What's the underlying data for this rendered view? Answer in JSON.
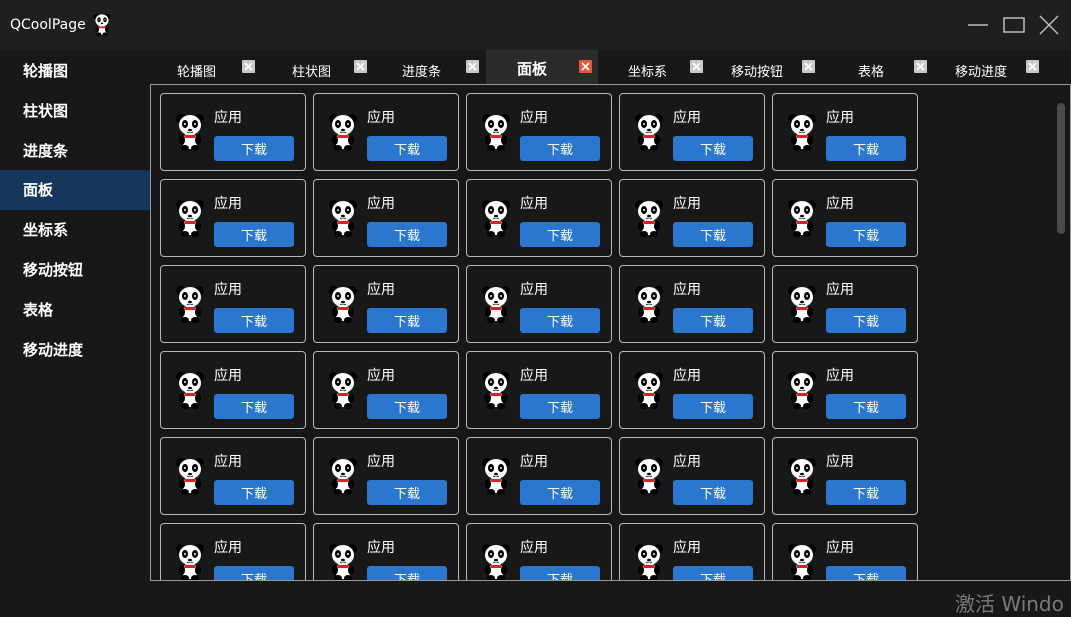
{
  "window": {
    "title": "QCoolPage"
  },
  "sidebar": {
    "items": [
      {
        "label": "轮播图"
      },
      {
        "label": "柱状图"
      },
      {
        "label": "进度条"
      },
      {
        "label": "面板"
      },
      {
        "label": "坐标系"
      },
      {
        "label": "移动按钮"
      },
      {
        "label": "表格"
      },
      {
        "label": "移动进度"
      }
    ],
    "active_index": 3
  },
  "tabs": {
    "items": [
      {
        "label": "轮播图"
      },
      {
        "label": "柱状图"
      },
      {
        "label": "进度条"
      },
      {
        "label": "面板"
      },
      {
        "label": "坐标系"
      },
      {
        "label": "移动按钮"
      },
      {
        "label": "表格"
      },
      {
        "label": "移动进度"
      }
    ],
    "active_index": 3
  },
  "panel": {
    "rows": 6,
    "cols": 5,
    "card": {
      "title": "应用",
      "button": "下载"
    }
  },
  "watermark": "激活 Windo",
  "colors": {
    "accent": "#2b76cf",
    "active_sidebar": "#17365c",
    "active_tab_close": "#e8563f"
  }
}
